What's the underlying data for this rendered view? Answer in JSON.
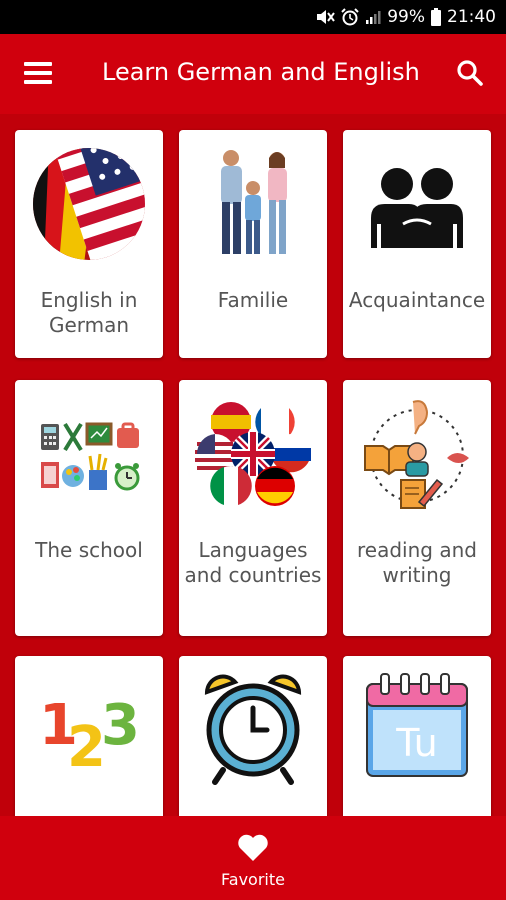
{
  "status_bar": {
    "battery": "99%",
    "time": "21:40"
  },
  "app_bar": {
    "title": "Learn German and English"
  },
  "categories": [
    {
      "label": "English in German",
      "icon": "germany-usa-flags-icon"
    },
    {
      "label": "Familie",
      "icon": "family-icon"
    },
    {
      "label": "Acquaintance",
      "icon": "acquaintance-icon"
    },
    {
      "label": "The school",
      "icon": "school-supplies-icon"
    },
    {
      "label": "Languages and countries",
      "icon": "world-flags-icon"
    },
    {
      "label": "reading and writing",
      "icon": "reading-writing-icon"
    },
    {
      "label": "",
      "icon": "numbers-123-icon"
    },
    {
      "label": "",
      "icon": "alarm-clock-icon"
    },
    {
      "label": "",
      "icon": "calendar-icon",
      "icon_text": "Tu"
    }
  ],
  "bottom_bar": {
    "favorite_label": "Favorite"
  },
  "colors": {
    "primary": "#d0000d",
    "background": "#c0000a",
    "card": "#ffffff",
    "label_text": "#555555"
  }
}
